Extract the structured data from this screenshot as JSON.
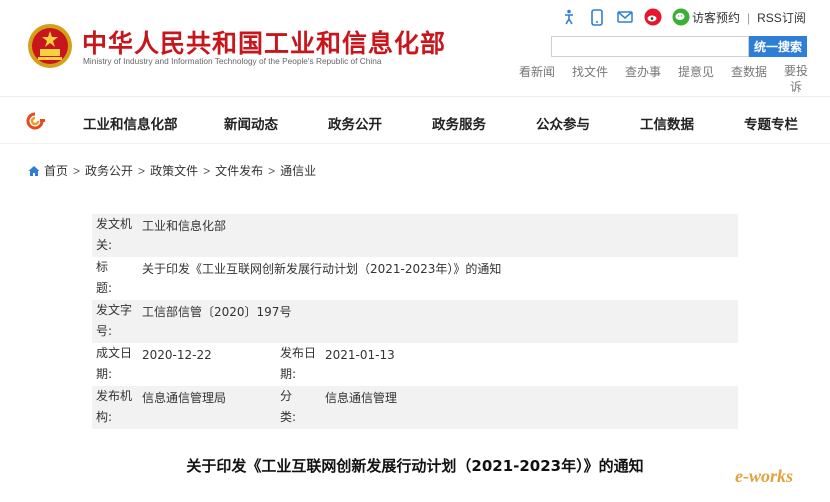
{
  "header": {
    "org_cn": "中华人民共和国工业和信息化部",
    "org_en": "Ministry of Industry and Information Technology of the People's Republic of China",
    "top_links": {
      "visitor": "访客预约",
      "separator": "|",
      "rss": "RSS订阅"
    },
    "top_icons": [
      "accessibility-icon",
      "mobile-icon",
      "mail-icon",
      "weibo-icon",
      "wechat-icon"
    ],
    "search": {
      "placeholder": "",
      "button": "统一搜索"
    },
    "quick_links": [
      "看新闻",
      "找文件",
      "查办事",
      "提意见",
      "查数据",
      "要投诉"
    ]
  },
  "nav": {
    "items": [
      "工业和信息化部",
      "新闻动态",
      "政务公开",
      "政务服务",
      "公众参与",
      "工信数据",
      "专题专栏"
    ]
  },
  "breadcrumb": [
    "首页",
    "政务公开",
    "政策文件",
    "文件发布",
    "通信业"
  ],
  "breadcrumb_sep": ">",
  "meta": {
    "issuer_label": "发文机关:",
    "issuer": "工业和信息化部",
    "title_label": "标　　题:",
    "title": "关于印发《工业互联网创新发展行动计划（2021-2023年）》的通知",
    "docno_label": "发文字号:",
    "docno": "工信部信管〔2020〕197号",
    "date_label": "成文日期:",
    "date": "2020-12-22",
    "pubdate_label": "发布日期:",
    "pubdate": "2021-01-13",
    "office_label": "发布机构:",
    "office": "信息通信管理局",
    "category_label": "分　　类:",
    "category": "信息通信管理"
  },
  "doc_title": "关于印发《工业互联网创新发展行动计划（2021-2023年）》的通知",
  "watermark": "e-works",
  "colors": {
    "brand_red": "#c8161d",
    "search_blue": "#2e7ed6",
    "row_shade": "#f2f2f2"
  }
}
